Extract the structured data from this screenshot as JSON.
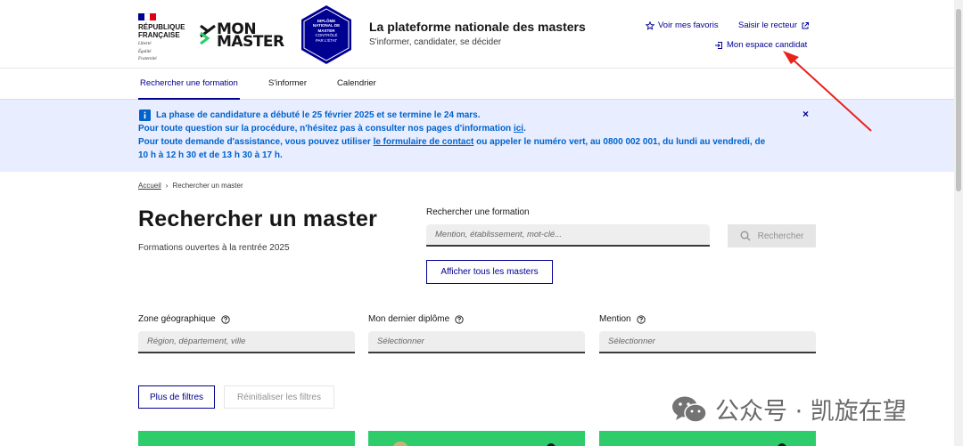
{
  "gov": {
    "name_line1": "RÉPUBLIQUE",
    "name_line2": "FRANÇAISE",
    "motto1": "Liberté",
    "motto2": "Égalité",
    "motto3": "Fraternité"
  },
  "brand": {
    "logo_line1": "MON",
    "logo_line2": "MASTER",
    "badge_line1": "DIPLÔME",
    "badge_line2": "NATIONAL DE",
    "badge_line3": "MASTER",
    "badge_line4": "CONTRÔLÉ",
    "badge_line5": "PAR L'ÉTAT",
    "title": "La plateforme nationale des masters",
    "subtitle": "S'informer, candidater, se décider"
  },
  "header_links": {
    "favorites": "Voir mes favoris",
    "rector": "Saisir le recteur",
    "candidate_space": "Mon espace candidat"
  },
  "nav": {
    "tabs": [
      "Rechercher une formation",
      "S'informer",
      "Calendrier"
    ],
    "active": 0
  },
  "notice": {
    "line1": "La phase de candidature a débuté le 25 février 2025 et se termine le 24 mars.",
    "line2_pre": "Pour toute question sur la procédure, n'hésitez pas à consulter nos pages d'information ",
    "line2_link": "ici",
    "line2_post": ".",
    "line3_pre": "Pour toute demande d'assistance, vous pouvez utiliser ",
    "line3_link": "le formulaire de contact",
    "line3_post": " ou appeler le numéro vert, au 0800 002 001, du lundi au vendredi, de",
    "line4": "10 h à 12 h 30 et de 13 h 30 à 17 h.",
    "close": "×"
  },
  "breadcrumb": {
    "home": "Accueil",
    "separator": "›",
    "current": "Rechercher un master"
  },
  "main": {
    "title": "Rechercher un master",
    "subtitle": "Formations ouvertes à la rentrée 2025",
    "search_label": "Rechercher une formation",
    "search_placeholder": "Mention, établissement, mot-clé...",
    "search_button": "Rechercher",
    "show_all_button": "Afficher tous les masters"
  },
  "filters": {
    "zone_label": "Zone géographique",
    "zone_placeholder": "Région, département, ville",
    "diploma_label": "Mon dernier diplôme",
    "diploma_placeholder": "Sélectionner",
    "mention_label": "Mention",
    "mention_placeholder": "Sélectionner",
    "more_button": "Plus de filtres",
    "reset_button": "Réinitialiser les filtres"
  },
  "watermark": {
    "text": "公众号 · 凯旋在望"
  },
  "colors": {
    "primary": "#000091",
    "notice_bg": "#e8edff",
    "notice_text": "#0063cb",
    "card_green": "#2ecc6a",
    "annotation_red": "#e8231e"
  }
}
